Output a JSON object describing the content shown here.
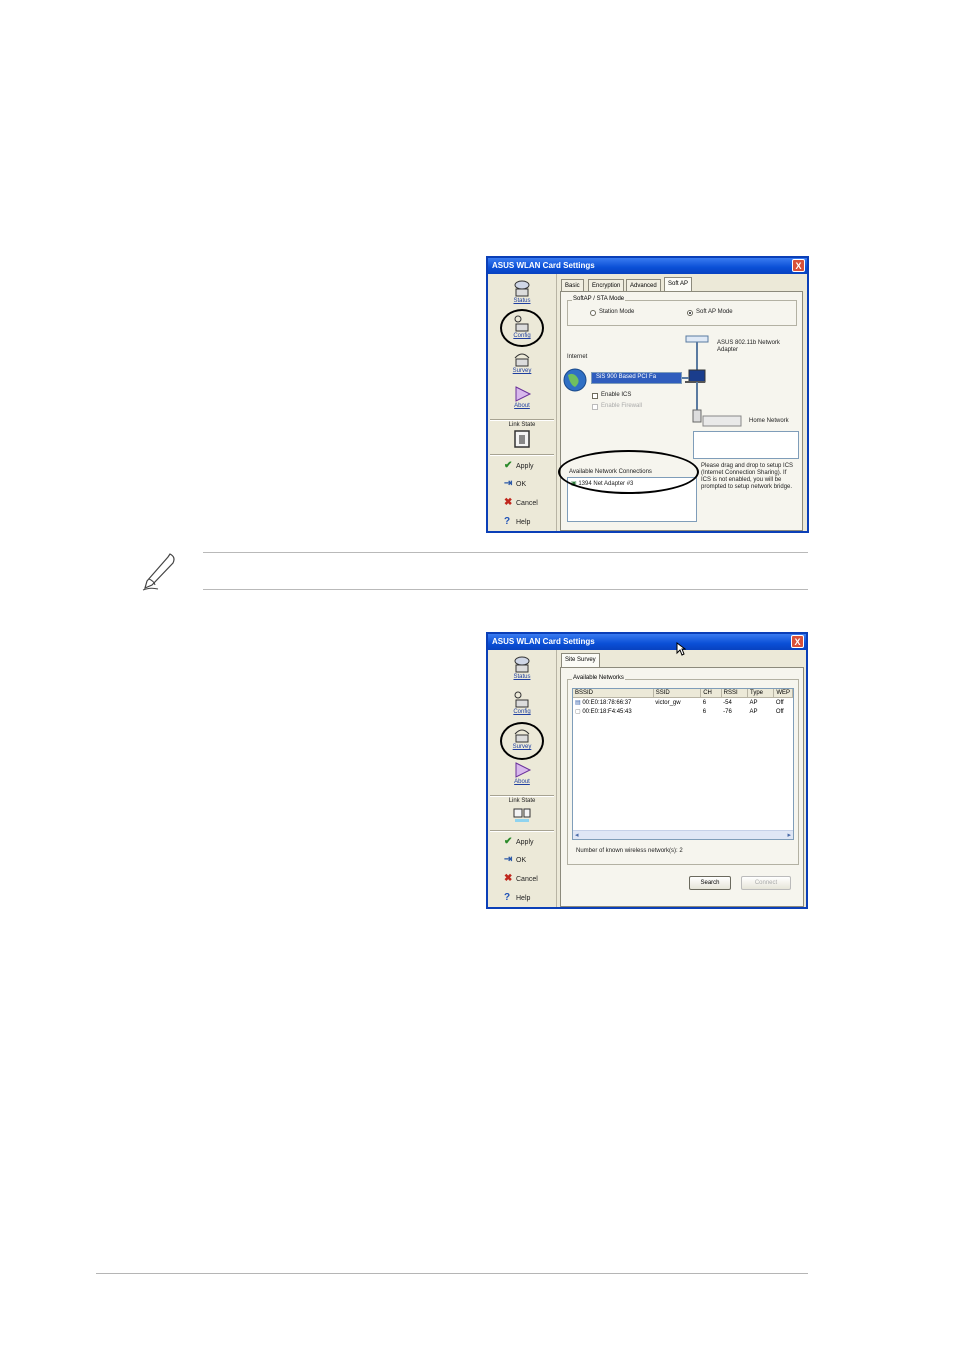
{
  "window1": {
    "title": "ASUS WLAN Card Settings",
    "close": "X",
    "nav": [
      {
        "label": "Status",
        "icon": "status-icon"
      },
      {
        "label": "Config",
        "icon": "config-icon"
      },
      {
        "label": "Survey",
        "icon": "survey-icon"
      },
      {
        "label": "About",
        "icon": "about-icon"
      }
    ],
    "link_state": "Link State",
    "actions": [
      {
        "label": "Apply",
        "glyph": "✔"
      },
      {
        "label": "OK",
        "glyph": "⇥"
      },
      {
        "label": "Cancel",
        "glyph": "✖"
      },
      {
        "label": "Help",
        "glyph": "?"
      }
    ],
    "tabs": [
      "Basic",
      "Encryption",
      "Advanced",
      "Soft AP"
    ],
    "mode_group": "SoftAP / STA Mode",
    "station_mode": "Station Mode",
    "soft_ap_mode": "Soft AP Mode",
    "adapter_label": "ASUS 802.11b Network Adapter",
    "internet_label": "Internet",
    "selected_adapter": "SiS 900 Based PCI Fa",
    "enable_ics": "Enable ICS",
    "enable_firewall": "Enable Firewall",
    "home_network": "Home Network",
    "available_connections": "Available Network Connections",
    "connection_item": "1394 Net Adapter #3",
    "help_text": "Please drag and drop to setup ICS (Internet Connection Sharing). If ICS is not enabled, you will be prompted to setup network bridge."
  },
  "window2": {
    "title": "ASUS WLAN Card Settings",
    "close": "X",
    "nav": [
      {
        "label": "Status",
        "icon": "status-icon"
      },
      {
        "label": "Config",
        "icon": "config-icon"
      },
      {
        "label": "Survey",
        "icon": "survey-icon"
      },
      {
        "label": "About",
        "icon": "about-icon"
      }
    ],
    "link_state": "Link State",
    "actions": [
      {
        "label": "Apply",
        "glyph": "✔"
      },
      {
        "label": "OK",
        "glyph": "⇥"
      },
      {
        "label": "Cancel",
        "glyph": "✖"
      },
      {
        "label": "Help",
        "glyph": "?"
      }
    ],
    "tab": "Site Survey",
    "group": "Available Networks",
    "columns": [
      "BSSID",
      "SSID",
      "CH",
      "RSSI",
      "Type",
      "WEP"
    ],
    "rows": [
      [
        "00:E0:18:78:66:37",
        "victor_gw",
        "6",
        "-54",
        "AP",
        "Off"
      ],
      [
        "00:E0:18:F4:45:43",
        "",
        "6",
        "-76",
        "AP",
        "Off"
      ]
    ],
    "count_text": "Number of known wireless network(s): 2",
    "search": "Search",
    "connect": "Connect"
  }
}
